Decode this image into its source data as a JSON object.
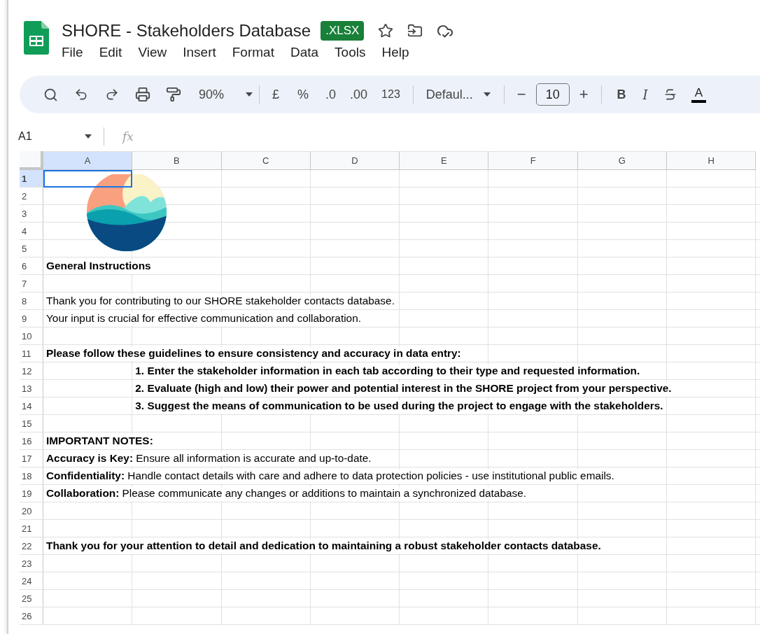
{
  "document": {
    "title": "SHORE - Stakeholders Database",
    "badge": ".XLSX"
  },
  "menu": [
    "File",
    "Edit",
    "View",
    "Insert",
    "Format",
    "Data",
    "Tools",
    "Help"
  ],
  "toolbar": {
    "zoom": "90%",
    "currency": "£",
    "percent": "%",
    "decrease_decimals": ".0",
    "increase_decimals": ".00",
    "number_format": "123",
    "font": "Defaul...",
    "minus": "−",
    "font_size": "10",
    "plus": "+",
    "bold": "B",
    "italic": "I",
    "text_color": "A"
  },
  "formula_bar": {
    "cell_ref": "A1",
    "fx": "fx"
  },
  "columns": [
    {
      "label": "A",
      "selected": true
    },
    {
      "label": "B",
      "selected": false
    },
    {
      "label": "C",
      "selected": false
    },
    {
      "label": "D",
      "selected": false
    },
    {
      "label": "E",
      "selected": false
    },
    {
      "label": "F",
      "selected": false
    },
    {
      "label": "G",
      "selected": false
    },
    {
      "label": "H",
      "selected": false
    }
  ],
  "rows": [
    {
      "label": "1",
      "selected": true
    },
    {
      "label": "2",
      "selected": false
    },
    {
      "label": "3",
      "selected": false
    },
    {
      "label": "4",
      "selected": false
    },
    {
      "label": "5",
      "selected": false
    },
    {
      "label": "6",
      "selected": false,
      "text": "General Instructions",
      "kind": "plain",
      "bold": true
    },
    {
      "label": "7",
      "selected": false
    },
    {
      "label": "8",
      "selected": false,
      "text": "Thank you for contributing to our SHORE stakeholder contacts database.",
      "kind": "plain",
      "bold": false
    },
    {
      "label": "9",
      "selected": false,
      "text": "Your input is crucial for effective communication and collaboration.",
      "kind": "plain",
      "bold": false
    },
    {
      "label": "10",
      "selected": false
    },
    {
      "label": "11",
      "selected": false,
      "text": "Please follow these guidelines to ensure consistency and accuracy in data entry:",
      "kind": "plain",
      "bold": true
    },
    {
      "label": "12",
      "selected": false,
      "text": "1. Enter the stakeholder information in each tab according to their type and requested information.",
      "kind": "indented",
      "bold": true
    },
    {
      "label": "13",
      "selected": false,
      "text": "2. Evaluate (high and low) their power and potential interest in the SHORE project from your perspective.",
      "kind": "indented",
      "bold": true
    },
    {
      "label": "14",
      "selected": false,
      "text": "3. Suggest the means of communication to be used during the project to engage with the stakeholders.",
      "kind": "indented",
      "bold": true
    },
    {
      "label": "15",
      "selected": false
    },
    {
      "label": "16",
      "selected": false,
      "text": "IMPORTANT NOTES:",
      "kind": "plain",
      "bold": true
    },
    {
      "label": "17",
      "selected": false,
      "text": "**Accuracy is Key:** Ensure all information is accurate and up-to-date.",
      "kind": "plain",
      "bold": false
    },
    {
      "label": "18",
      "selected": false,
      "text": "**Confidentiality:** Handle contact details with care and adhere to data protection policies - use institutional public emails.",
      "kind": "plain",
      "bold": false
    },
    {
      "label": "19",
      "selected": false,
      "text": "**Collaboration:** Please communicate any changes or additions to maintain a synchronized database.",
      "kind": "plain",
      "bold": false
    },
    {
      "label": "20",
      "selected": false
    },
    {
      "label": "21",
      "selected": false
    },
    {
      "label": "22",
      "selected": false,
      "text": "Thank you for your attention to detail and dedication to maintaining a robust stakeholder contacts database.",
      "kind": "plain",
      "bold": true
    },
    {
      "label": "23",
      "selected": false
    },
    {
      "label": "24",
      "selected": false
    },
    {
      "label": "25",
      "selected": false
    },
    {
      "label": "26",
      "selected": false
    }
  ]
}
